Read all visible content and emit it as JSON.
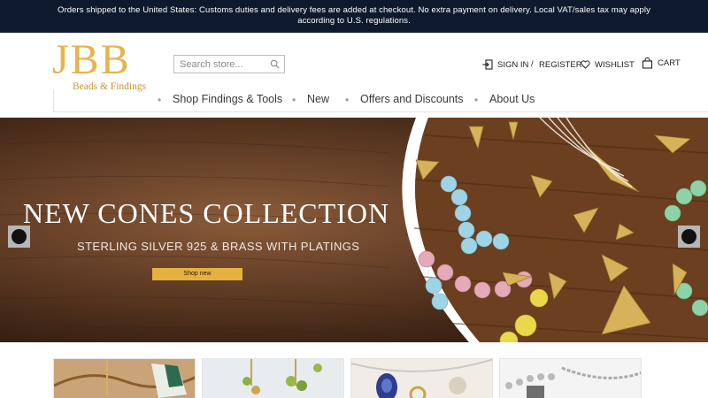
{
  "notice": {
    "text": "Orders shipped to the United States: Customs duties and delivery fees are added at checkout. No extra payment on delivery. Local VAT/sales tax may apply according to U.S. regulations."
  },
  "brand": {
    "logo_letters": "JBB",
    "logo_tagline": "Beads & Findings",
    "accent_color": "#e8b24e",
    "topbar_color": "#0d1a2e"
  },
  "search": {
    "placeholder": "Search store...",
    "value": "",
    "icon": "search-icon"
  },
  "account": {
    "sign_in": "SIGN IN",
    "separator": "/",
    "register": "REGISTER",
    "wishlist": "WISHLIST",
    "cart": "CART"
  },
  "nav": {
    "items": [
      {
        "label": "Shop Findings & Tools"
      },
      {
        "label": "New"
      },
      {
        "label": "Offers and Discounts"
      },
      {
        "label": "About Us"
      }
    ]
  },
  "hero": {
    "title": "NEW CONES COLLECTION",
    "subtitle": "STERLING SILVER 925 & BRASS WITH PLATINGS",
    "button_label": "Shop new",
    "button_color": "#e6b23f"
  },
  "thumbnails": [
    {
      "icon": "necklace-photo"
    },
    {
      "icon": "earrings-photo"
    },
    {
      "icon": "pendant-photo"
    },
    {
      "icon": "chain-photo"
    }
  ]
}
